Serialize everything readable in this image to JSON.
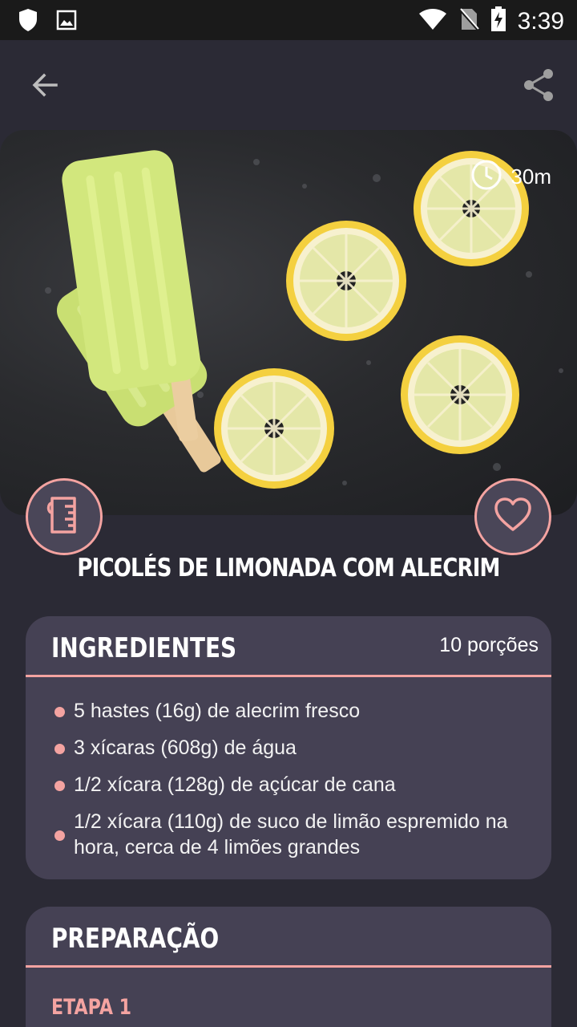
{
  "status_bar": {
    "time": "3:39",
    "icons": [
      "shield-icon",
      "image-icon",
      "wifi-icon",
      "no-sim-icon",
      "battery-charging-icon"
    ]
  },
  "app_bar": {
    "back_icon": "arrow-back-icon",
    "share_icon": "share-icon"
  },
  "hero": {
    "time_icon": "clock-icon",
    "time": "30m"
  },
  "recipe": {
    "title": "PICOLÉS DE LIMONADA COM ALECRIM"
  },
  "ingredients": {
    "title": "INGREDIENTES",
    "servings": "10 porções",
    "items": [
      "5 hastes (16g) de alecrim fresco",
      "3 xícaras (608g) de água",
      "1/2 xícara (128g) de açúcar de cana",
      "1/2 xícara (110g) de suco de limão espremido na hora, cerca de 4 limões grandes"
    ]
  },
  "preparation": {
    "title": "PREPARAÇÃO",
    "step_label": "ETAPA 1"
  },
  "colors": {
    "background": "#2b2a35",
    "card": "#454154",
    "accent": "#f4a3a1"
  }
}
